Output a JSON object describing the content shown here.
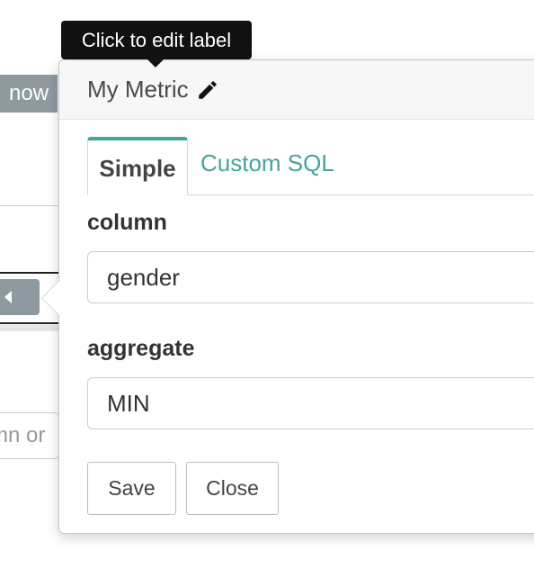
{
  "background": {
    "badge_text": "now",
    "input_fragment_text": "mn or"
  },
  "popover": {
    "metric_label": "My Metric",
    "tooltip": "Click to edit label",
    "tabs": [
      {
        "label": "Simple",
        "active": true
      },
      {
        "label": "Custom SQL",
        "active": false
      }
    ],
    "fields": {
      "column": {
        "label": "column",
        "value": "gender"
      },
      "aggregate": {
        "label": "aggregate",
        "value": "MIN"
      }
    },
    "buttons": {
      "save": "Save",
      "close": "Close"
    }
  },
  "icons": {
    "edit": "pencil-icon",
    "collapse": "caret-left-icon"
  },
  "colors": {
    "accent": "#46a49a",
    "badge": "#8e9aa0",
    "tooltip_bg": "#111111"
  }
}
